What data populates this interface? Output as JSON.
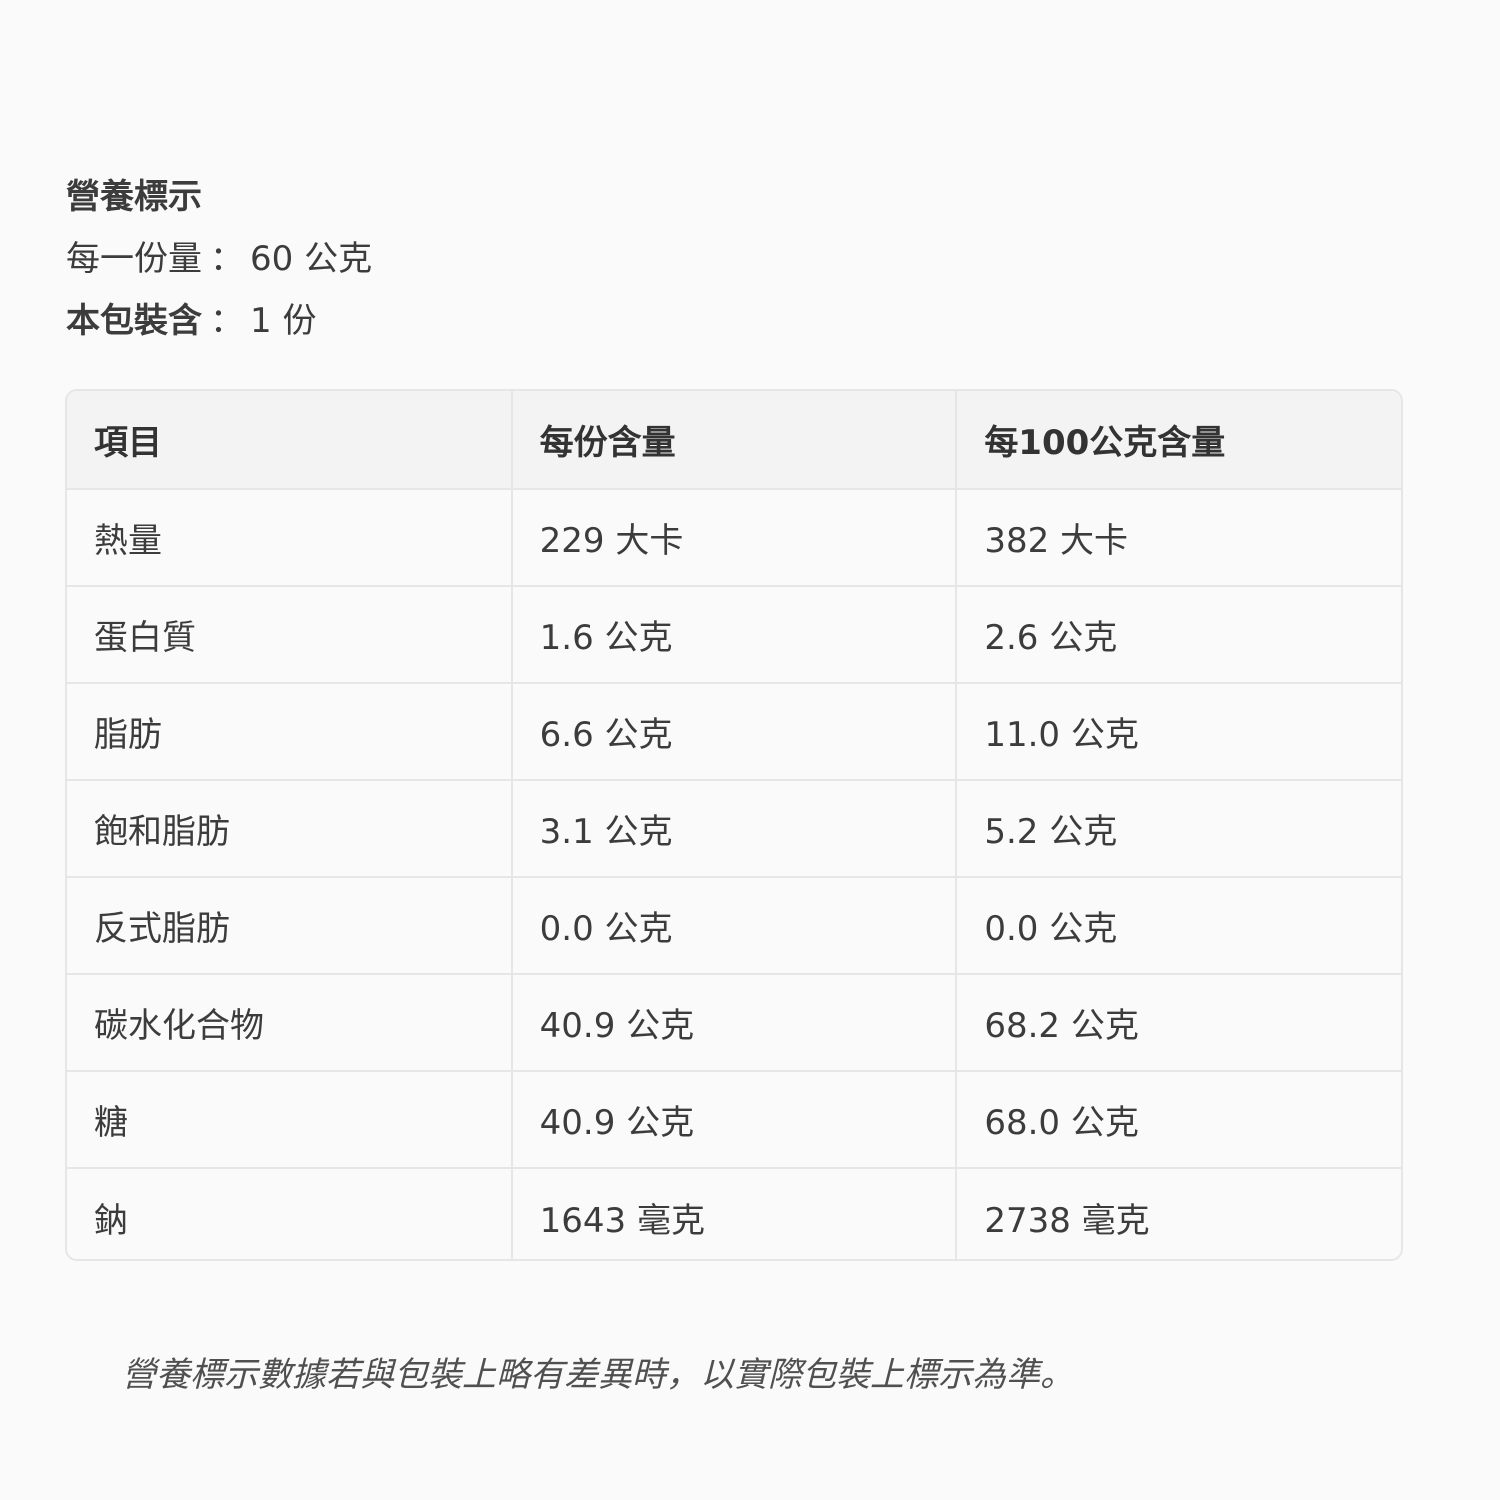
{
  "header": {
    "title": "營養標示",
    "serving_label": "每一份量",
    "serving_value": "60 公克",
    "package_label": "本包裝含",
    "package_value": "1 份",
    "separator": "："
  },
  "table": {
    "columns": [
      "項目",
      "每份含量",
      "每100公克含量"
    ],
    "rows": [
      {
        "item": "熱量",
        "per_serving": "229 大卡",
        "per_100g": "382 大卡"
      },
      {
        "item": "蛋白質",
        "per_serving": "1.6 公克",
        "per_100g": "2.6 公克"
      },
      {
        "item": "脂肪",
        "per_serving": "6.6 公克",
        "per_100g": "11.0 公克"
      },
      {
        "item": "飽和脂肪",
        "per_serving": "3.1 公克",
        "per_100g": "5.2 公克"
      },
      {
        "item": "反式脂肪",
        "per_serving": "0.0 公克",
        "per_100g": "0.0 公克"
      },
      {
        "item": "碳水化合物",
        "per_serving": "40.9 公克",
        "per_100g": "68.2 公克"
      },
      {
        "item": "糖",
        "per_serving": "40.9 公克",
        "per_100g": "68.0 公克"
      },
      {
        "item": "鈉",
        "per_serving": "1643 毫克",
        "per_100g": "2738 毫克"
      }
    ]
  },
  "footnote": "營養標示數據若與包裝上略有差異時，以實際包裝上標示為準。"
}
